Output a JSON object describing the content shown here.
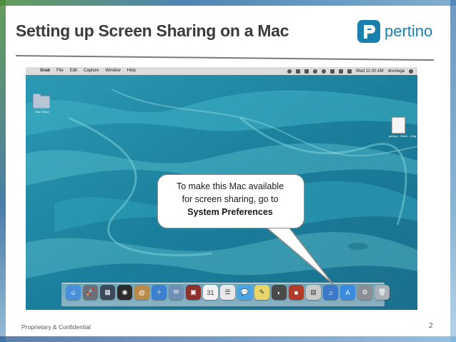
{
  "slide": {
    "title": "Setting up Screen Sharing on a Mac",
    "logo_text": "pertino",
    "footer_left": "Proprietary & Confidential",
    "page_number": "2"
  },
  "menubar": {
    "items": [
      "Grab",
      "File",
      "Edit",
      "Capture",
      "Window",
      "Help"
    ],
    "clock": "Wed 11:00 AM",
    "user": "dnoriega"
  },
  "desktop": {
    "folder_label": "Mac Share",
    "document_label": "pertino - Client ...dmg"
  },
  "callout": {
    "line1": "To make this Mac available",
    "line2": "for screen sharing, go to",
    "line3": "System Preferences"
  },
  "dock": {
    "icons": [
      {
        "name": "finder-icon",
        "color": "#4a90d9",
        "glyph": "☺"
      },
      {
        "name": "launchpad-icon",
        "color": "#6b6f78",
        "glyph": "🚀"
      },
      {
        "name": "mission-control-icon",
        "color": "#3a4a5c",
        "glyph": "▦"
      },
      {
        "name": "dashboard-icon",
        "color": "#2b2b2b",
        "glyph": "◉"
      },
      {
        "name": "contacts-icon",
        "color": "#b98a4a",
        "glyph": "@"
      },
      {
        "name": "safari-icon",
        "color": "#3d7fd0",
        "glyph": "✧"
      },
      {
        "name": "mail-icon",
        "color": "#6f8fb5",
        "glyph": "✉"
      },
      {
        "name": "photo-booth-icon",
        "color": "#8b2f2f",
        "glyph": "▣"
      },
      {
        "name": "calendar-icon",
        "color": "#f2f2f2",
        "glyph": "31"
      },
      {
        "name": "reminders-icon",
        "color": "#e8e8e8",
        "glyph": "☰"
      },
      {
        "name": "messages-icon",
        "color": "#4aa4e8",
        "glyph": "💬"
      },
      {
        "name": "notes-icon",
        "color": "#e9d66b",
        "glyph": "✎"
      },
      {
        "name": "facetime-icon",
        "color": "#4a4a4a",
        "glyph": "◐"
      },
      {
        "name": "photobooth-icon",
        "color": "#b23a2a",
        "glyph": "■"
      },
      {
        "name": "preview-icon",
        "color": "#c9c9c9",
        "glyph": "▤"
      },
      {
        "name": "itunes-icon",
        "color": "#3a78c8",
        "glyph": "♫"
      },
      {
        "name": "app-store-icon",
        "color": "#3a8be0",
        "glyph": "A"
      },
      {
        "name": "system-preferences-icon",
        "color": "#8a8e95",
        "glyph": "⚙"
      },
      {
        "name": "trash-icon",
        "color": "#a9b0b8",
        "glyph": "🗑"
      }
    ]
  }
}
